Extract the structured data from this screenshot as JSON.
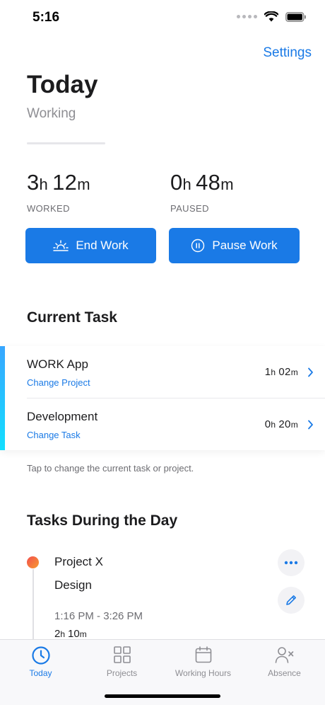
{
  "status_bar": {
    "time": "5:16"
  },
  "header": {
    "settings_label": "Settings"
  },
  "today": {
    "title": "Today",
    "state": "Working",
    "worked": {
      "h": "3",
      "h_unit": "h",
      "m": "12",
      "m_unit": "m",
      "label": "WORKED"
    },
    "paused": {
      "h": "0",
      "h_unit": "h",
      "m": "48",
      "m_unit": "m",
      "label": "PAUSED"
    },
    "end_work_label": "End Work",
    "pause_work_label": "Pause Work"
  },
  "current_task": {
    "title": "Current Task",
    "project": {
      "name": "WORK App",
      "link": "Change Project",
      "h": "1",
      "h_unit": "h",
      "m": "02",
      "m_unit": "m"
    },
    "task": {
      "name": "Development",
      "link": "Change Task",
      "h": "0",
      "h_unit": "h",
      "m": "20",
      "m_unit": "m"
    },
    "hint": "Tap to change the current task or project."
  },
  "day_tasks": {
    "title": "Tasks During the Day",
    "entries": [
      {
        "project": "Project X",
        "task": "Design",
        "range": "1:16 PM - 3:26 PM",
        "h": "2",
        "h_unit": "h",
        "m": "10",
        "m_unit": "m"
      }
    ]
  },
  "tabs": [
    {
      "label": "Today",
      "icon": "clock-icon",
      "active": true
    },
    {
      "label": "Projects",
      "icon": "grid-icon",
      "active": false
    },
    {
      "label": "Working Hours",
      "icon": "calendar-icon",
      "active": false
    },
    {
      "label": "Absence",
      "icon": "person-x-icon",
      "active": false
    }
  ],
  "colors": {
    "accent": "#1a7ae6",
    "text": "#1c1c1e",
    "secondary": "#8e8e93"
  }
}
